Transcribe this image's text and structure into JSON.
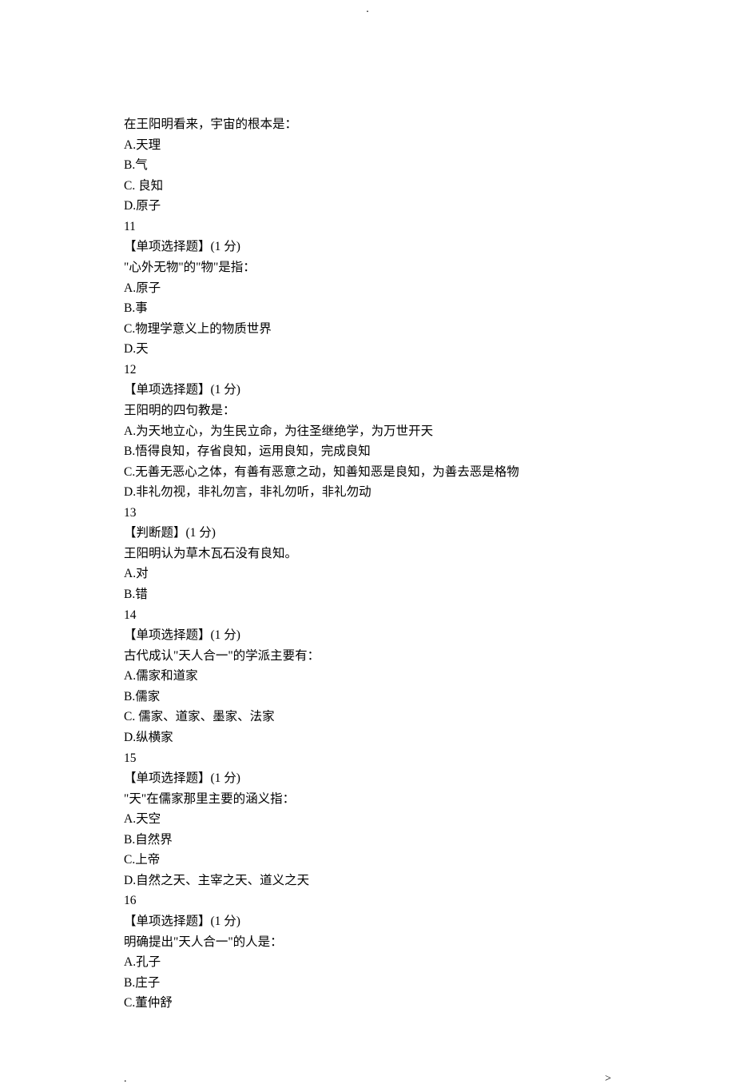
{
  "top_marker": ".",
  "questions": [
    {
      "stem": "在王阳明看来，宇宙的根本是：",
      "options": [
        "A.天理",
        "B.气",
        "C. 良知",
        "D.原子"
      ]
    },
    {
      "number": "11",
      "type_label": "【单项选择题】(1 分)",
      "stem": "\"心外无物\"的\"物\"是指：",
      "options": [
        "A.原子",
        "B.事",
        "C.物理学意义上的物质世界",
        "D.天"
      ]
    },
    {
      "number": "12",
      "type_label": "【单项选择题】(1 分)",
      "stem": "王阳明的四句教是：",
      "options": [
        "A.为天地立心，为生民立命，为往圣继绝学，为万世开天",
        "B.悟得良知，存省良知，运用良知，完成良知",
        "C.无善无恶心之体，有善有恶意之动，知善知恶是良知，为善去恶是格物",
        "D.非礼勿视，非礼勿言，非礼勿听，非礼勿动"
      ]
    },
    {
      "number": "13",
      "type_label": "【判断题】(1 分)",
      "stem": "王阳明认为草木瓦石没有良知。",
      "options": [
        "A.对",
        "B.错"
      ]
    },
    {
      "number": "14",
      "type_label": "【单项选择题】(1 分)",
      "stem": "古代成认\"天人合一\"的学派主要有：",
      "options": [
        "A.儒家和道家",
        "B.儒家",
        "C. 儒家、道家、墨家、法家",
        "D.纵横家"
      ]
    },
    {
      "number": "15",
      "type_label": "【单项选择题】(1 分)",
      "stem": "\"天\"在儒家那里主要的涵义指：",
      "options": [
        "A.天空",
        "B.自然界",
        "C.上帝",
        "D.自然之天、主宰之天、道义之天"
      ]
    },
    {
      "number": "16",
      "type_label": "【单项选择题】(1 分)",
      "stem": "明确提出\"天人合一\"的人是：",
      "options": [
        "A.孔子",
        "B.庄子",
        "C.董仲舒"
      ]
    }
  ],
  "footer_left": ".",
  "footer_right": ">"
}
